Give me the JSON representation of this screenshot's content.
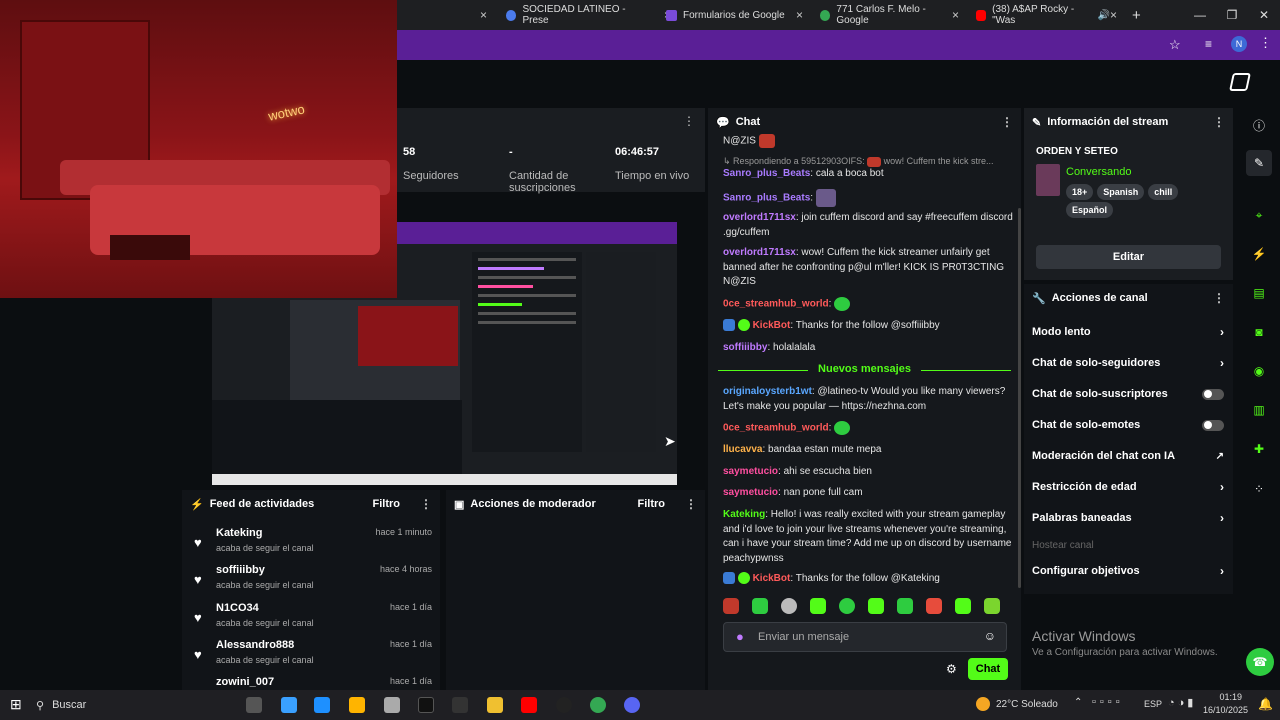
{
  "browser": {
    "tabs": [
      {
        "label": "SOCIEDAD LATINEO - Prese",
        "color": "#4b7bec"
      },
      {
        "label": "Formularios de Google",
        "color": "#7a4bd8"
      },
      {
        "label": "771 Carlos F. Melo - Google",
        "color": "#34a853"
      },
      {
        "label": "(38) A$AP Rocky - \"Was",
        "color": "#ff0000"
      }
    ],
    "new_tab": "+",
    "close": "×",
    "profile_initial": "N",
    "window_controls": [
      "—",
      "❐",
      "✕"
    ]
  },
  "webcam": {
    "neon_text": "wotwo"
  },
  "stats": {
    "followers_value": "58",
    "followers_label": "Seguidores",
    "subs_value": "-",
    "subs_label": "Cantidad de suscripciones",
    "live_value": "06:46:57",
    "live_label": "Tiempo en vivo"
  },
  "activity": {
    "title": "Feed de actividades",
    "filter": "Filtro",
    "items": [
      {
        "name": "Kateking",
        "action": "acaba de seguir el canal",
        "time": "hace 1 minuto"
      },
      {
        "name": "soffiiibby",
        "action": "acaba de seguir el canal",
        "time": "hace 4 horas"
      },
      {
        "name": "N1CO34",
        "action": "acaba de seguir el canal",
        "time": "hace 1 día"
      },
      {
        "name": "Alessandro888",
        "action": "acaba de seguir el canal",
        "time": "hace 1 día"
      },
      {
        "name": "zowini_007",
        "action": "",
        "time": "hace 1 día"
      }
    ]
  },
  "mod": {
    "title": "Acciones de moderador",
    "filter": "Filtro"
  },
  "chat": {
    "title": "Chat",
    "m0": "N@ZIS",
    "reply": "↳ Respondiendo a 59512903OIFS:",
    "reply_text": "wow! Cuffem the kick stre...",
    "m1_user": "Sanro_plus_Beats",
    "m1_text": ": cala a boca bot",
    "m2_user": "Sanro_plus_Beats",
    "m2_text": ":",
    "m3_user": "overlord1711sx",
    "m3_text": ": join cuffem discord and say #freecuffem discord .gg/cuffem",
    "m4_user": "overlord1711sx",
    "m4_text": ": wow! Cuffem the kick streamer unfairly get banned after he confronting p@ul m'ller! KICK IS PR0T3CTING N@ZIS",
    "m5_user": "0ce_streamhub_world",
    "m5_text": ":",
    "m6_user": "KickBot",
    "m6_text": ": Thanks for the follow @soffiiibby",
    "m7_user": "soffiiibby",
    "m7_text": ": holalalala",
    "new_messages": "Nuevos mensajes",
    "m8_user": "originaloysterb1wt",
    "m8_text": ": @latineo-tv Would you like many viewers? Let's make you popular — https://nezhna.com",
    "m9_user": "0ce_streamhub_world",
    "m9_text": ":",
    "m10_user": "llucavva",
    "m10_text": ": bandaa estan mute mepa",
    "m11_user": "saymetucio",
    "m11_text": ": ahi se escucha bien",
    "m12_user": "saymetucio",
    "m12_text": ": nan pone full cam",
    "m13_user": "Kateking",
    "m13_text": ": Hello! i was really excited with your stream gameplay and i'd love to join your live streams whenever you're streaming, can i have your stream time? Add me up on discord by username peachypwnss",
    "m14_user": "KickBot",
    "m14_text": ": Thanks for the follow @Kateking",
    "input_placeholder": "Enviar un mensaje",
    "send": "Chat"
  },
  "info": {
    "title": "Información del stream",
    "stream_title": "ORDEN Y SETEO",
    "category": "Conversando",
    "tags": [
      "18+",
      "Spanish",
      "chill",
      "Español"
    ],
    "edit": "Editar"
  },
  "actions": {
    "title": "Acciones de canal",
    "items": [
      "Modo lento",
      "Chat de solo-seguidores",
      "Chat de solo-suscriptores",
      "Chat de solo-emotes",
      "Moderación del chat con IA",
      "Restricción de edad",
      "Palabras baneadas",
      "Hostear canal",
      "Configurar objetivos"
    ]
  },
  "windows": {
    "activate_title": "Activar Windows",
    "activate_sub": "Ve a Configuración para activar Windows.",
    "search": "Buscar",
    "weather": "22°C  Soleado",
    "lang": "ESP",
    "time": "01:19",
    "date": "16/10/2025"
  }
}
